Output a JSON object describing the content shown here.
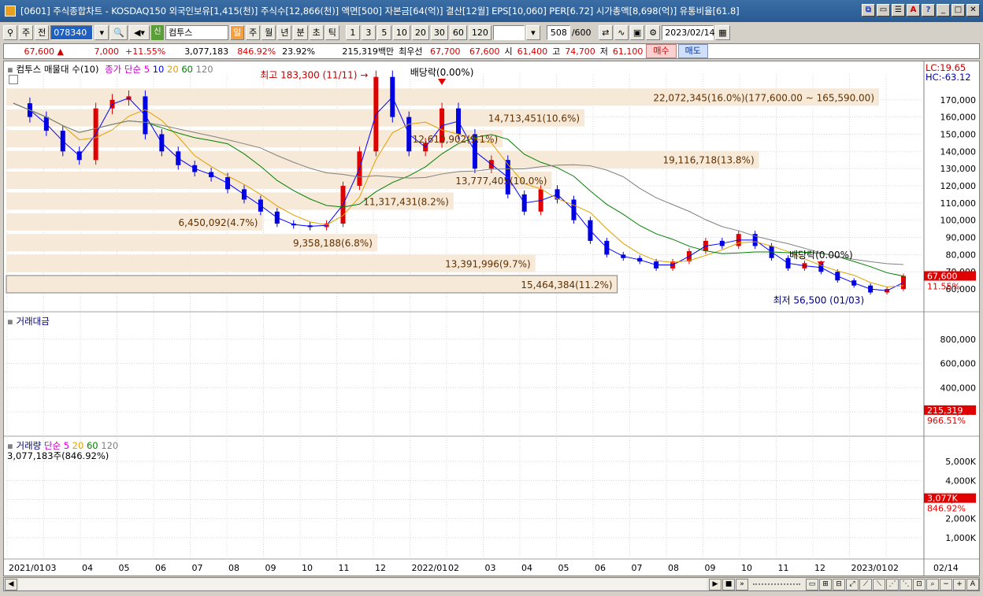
{
  "window": {
    "title": "[0601] 주식종합차트 - KOSDAQ150 외국인보유[1,415(천)] 주식수[12,866(천)] 액면[500] 자본금[64(억)] 결산[12월] EPS[10,060] PER[6.72] 시가총액[8,698(억)] 유통비율[61.8]",
    "buttons": [
      "restore",
      "minimize",
      "list",
      "alert",
      "help",
      "min",
      "max",
      "close"
    ]
  },
  "toolbar": {
    "market_select": "주",
    "prev_label": "전",
    "code": "078340",
    "stock_badge": "신",
    "stock_name": "컴투스",
    "periods": [
      "일",
      "주",
      "월",
      "년",
      "분",
      "초",
      "틱"
    ],
    "active_period": "일",
    "intervals": [
      "1",
      "3",
      "5",
      "10",
      "20",
      "30",
      "60",
      "120"
    ],
    "count": "508",
    "count_total": "/600",
    "date": "2023/02/14"
  },
  "quote": {
    "price": "67,600",
    "arrow": "▲",
    "change": "7,000",
    "change_pct": "+11.55%",
    "volume": "3,077,183",
    "vol_ratio": "846.92%",
    "turnover": "23.92%",
    "amount": "215,319백만",
    "priority_label": "최우선",
    "ask": "67,700",
    "bid": "67,600",
    "open_label": "시",
    "open": "61,400",
    "high_label": "고",
    "high": "74,700",
    "low_label": "저",
    "low": "61,100",
    "buy_label": "매수",
    "sell_label": "매도"
  },
  "price_panel": {
    "title": "컴투스 매물대 수(10)",
    "ma_label": "종가 단순",
    "ma_periods": [
      "5",
      "10",
      "20",
      "60",
      "120"
    ],
    "ma_colors": [
      "#e000e0",
      "#0000ff",
      "#e0a000",
      "#008000",
      "#808080"
    ],
    "lc_label": "LC:19.65",
    "hc_label": "HC:-63.12",
    "current_price_tag": "67,600",
    "current_pct_tag": "11.55%",
    "high_annotation": "최고 183,300 (11/11)",
    "low_annotation": "최저 56,500 (01/03)",
    "dividend_label_1": "배당락(0.00%)",
    "dividend_label_2": "배당락(0.00%)",
    "volume_profile": [
      {
        "label": "22,072,345(16.0%)(177,600.00 ~ 165,590.00)",
        "price": 171600,
        "width_pct": 16.0
      },
      {
        "label": "14,713,451(10.6%)",
        "price": 159500,
        "width_pct": 10.6
      },
      {
        "label": "12,610,902(9.1%)",
        "price": 147400,
        "width_pct": 9.1
      },
      {
        "label": "19,116,718(13.8%)",
        "price": 135300,
        "width_pct": 13.8
      },
      {
        "label": "13,777,405(10.0%)",
        "price": 123200,
        "width_pct": 10.0
      },
      {
        "label": "11,317,431(8.2%)",
        "price": 111100,
        "width_pct": 8.2
      },
      {
        "label": "6,450,092(4.7%)",
        "price": 99000,
        "width_pct": 4.7
      },
      {
        "label": "9,358,188(6.8%)",
        "price": 87000,
        "width_pct": 6.8
      },
      {
        "label": "13,391,996(9.7%)",
        "price": 74900,
        "width_pct": 9.7
      },
      {
        "label": "15,464,384(11.2%)",
        "price": 62800,
        "width_pct": 11.2
      }
    ],
    "y_ticks": [
      "170,000",
      "160,000",
      "150,000",
      "140,000",
      "130,000",
      "120,000",
      "110,000",
      "100,000",
      "90,000",
      "80,000",
      "70,000",
      "60,000"
    ]
  },
  "amount_panel": {
    "title": "거래대금",
    "y_ticks": [
      "800,000",
      "600,000",
      "400,000",
      "200,000"
    ],
    "current_tag": "215,319",
    "pct_tag": "966.51%"
  },
  "volume_panel": {
    "title": "거래량",
    "ma_label": "단순",
    "ma_periods": [
      "5",
      "20",
      "60",
      "120"
    ],
    "current_value": "3,077,183주(846.92%)",
    "y_ticks": [
      "5,000K",
      "4,000K",
      "3,000K",
      "2,000K",
      "1,000K"
    ],
    "current_tag": "3,077K",
    "pct_tag": "846.92%"
  },
  "x_axis": {
    "labels": [
      "2021/01",
      "03",
      "04",
      "05",
      "06",
      "07",
      "08",
      "09",
      "10",
      "11",
      "12",
      "2022/01",
      "02",
      "03",
      "04",
      "05",
      "06",
      "07",
      "08",
      "09",
      "10",
      "11",
      "12",
      "2023/01",
      "02"
    ],
    "right_label": "02/14"
  },
  "chart_data": {
    "type": "candlestick",
    "title": "컴투스",
    "ylim": [
      55000,
      185000
    ],
    "series": [
      {
        "name": "종가",
        "values": [
          168000,
          160000,
          152000,
          140000,
          135000,
          165000,
          170000,
          172000,
          150000,
          140000,
          132000,
          128000,
          125000,
          118000,
          112000,
          105000,
          98000,
          97000,
          96000,
          98000,
          120000,
          140000,
          183300,
          160000,
          140000,
          145000,
          165000,
          150000,
          130000,
          135000,
          115000,
          105000,
          118000,
          112000,
          100000,
          88000,
          80000,
          78000,
          76000,
          72000,
          76000,
          82000,
          88000,
          85000,
          92000,
          85000,
          78000,
          72000,
          75000,
          70000,
          65000,
          62000,
          58000,
          60000,
          67600
        ]
      }
    ]
  }
}
